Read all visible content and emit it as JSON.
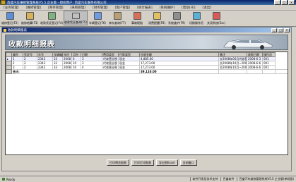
{
  "window": {
    "title": "百盛汽车维修管理系统V5.5 企业版 - 授权用户: 百盛汽车服务有限公司",
    "minimize": "_",
    "maximize": "□",
    "close": "×"
  },
  "menu": [
    "[业务管理]",
    "[维修管理]",
    "[库存管理]",
    "[采购管理]",
    "[财务管理]",
    "[客户管理]",
    "[统计报表]",
    "[系统维护]",
    "[帮助(H)]",
    "[退出]"
  ],
  "toolbar": [
    {
      "label": "维修登记(F2)",
      "icon": "wrench-icon",
      "color": "#5b8fd8"
    },
    {
      "label": "维修结算(F3)",
      "icon": "calculator-icon",
      "color": "#d8b25b"
    },
    {
      "label": "收款凭证登记(F4)",
      "icon": "receipt-icon",
      "color": "#7fb27f"
    },
    {
      "label": "收款凭证查询(F5)",
      "icon": "search-doc-icon",
      "color": "#c0c0c0"
    },
    {
      "label": "车辆登记(F6)",
      "icon": "car-icon",
      "color": "#6f9be0"
    },
    {
      "label": "库存查询(F7)",
      "icon": "box-icon",
      "color": "#b9a074"
    },
    {
      "label": "事故理赔",
      "icon": "claim-icon",
      "color": "#d86f5b"
    },
    {
      "label": "消费提醒(F8)",
      "icon": "bell-icon",
      "color": "#e0c060"
    },
    {
      "label": "系统维护(F9)",
      "icon": "gear-icon",
      "color": "#8f8f8f"
    },
    {
      "label": "切换操作员",
      "icon": "user-icon",
      "color": "#5bb0d8"
    },
    {
      "label": "关闭系统(Esc)",
      "icon": "power-icon",
      "color": "#d85b5b"
    }
  ],
  "child_window": {
    "title": "收款明细报表",
    "heading": "收款明细报表"
  },
  "table": {
    "columns": [
      "编号",
      "凭证号",
      "车号",
      "车辆编号",
      "年份",
      "月份",
      "日期",
      "费用类型",
      "付款类型",
      "应收金额",
      "备注",
      "收款日期",
      "操作员"
    ],
    "rows": [
      [
        "1",
        "2",
        "2343",
        "33",
        "2008",
        "6",
        "3",
        "代收营业税",
        "现金",
        "4,885.00",
        "交2008年06月代收营业税(汇)",
        "2008-6-3",
        "001"
      ],
      [
        "2",
        "2",
        "2343",
        "33",
        "2008",
        "10",
        "3",
        "代收营业税",
        "现金",
        "17,273.00",
        "交2008年10月~2008年10月代收营业税(汇)",
        "2008-6-6",
        "001"
      ],
      [
        "3",
        "2",
        "2343",
        "33",
        "2008",
        "10",
        "4",
        "代收营业税",
        "现金",
        "17,273.00",
        "交2008年10月~2008年10月代收营业税(汇)",
        "2008-6-6",
        "001"
      ]
    ],
    "total_label": "合计:",
    "total_value": "39,110.00"
  },
  "buttons": {
    "preview": "打印预览报表",
    "print": "打印打印报表",
    "export": "导出到Excel",
    "close": "关闭窗口"
  },
  "status": {
    "ready": "Ready",
    "text1": "软件开发及技术支持",
    "text2": "百盛软件",
    "text3": "百盛汽车维修管理系统V5.5 企业版(单机版)"
  }
}
